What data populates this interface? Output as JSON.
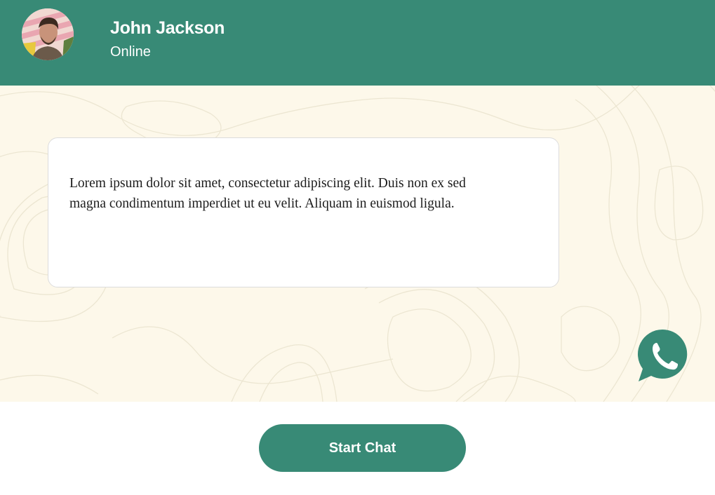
{
  "contact": {
    "name": "John Jackson",
    "status": "Online"
  },
  "message": {
    "text": "Lorem ipsum dolor sit amet, consectetur adipiscing elit. Duis non ex sed magna condimentum imperdiet ut eu velit. Aliquam in euismod ligula."
  },
  "actions": {
    "start_chat_label": "Start Chat"
  },
  "icons": {
    "avatar": "profile-photo",
    "badge": "whatsapp-icon"
  },
  "colors": {
    "brand": "#388a76",
    "chat_background": "#fdf8ea",
    "bubble": "#ffffff"
  }
}
